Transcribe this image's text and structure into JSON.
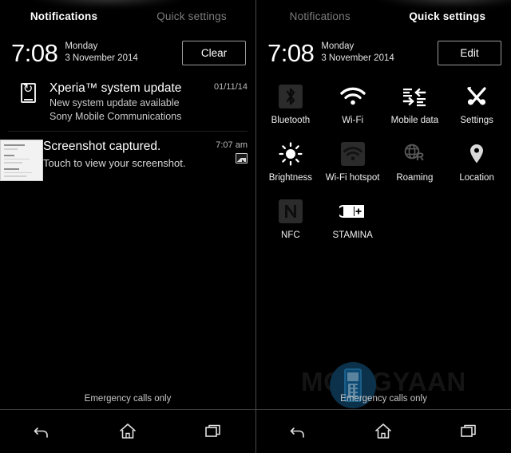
{
  "panels": {
    "left": {
      "tabs": [
        {
          "label": "Notifications",
          "active": true
        },
        {
          "label": "Quick settings",
          "active": false
        }
      ],
      "clock": {
        "time": "7:08",
        "day": "Monday",
        "date": "3 November 2014"
      },
      "action_button": "Clear",
      "notifications": [
        {
          "icon": "xperia-update-icon",
          "title": "Xperia™ system update",
          "line1": "New system update available",
          "line2": "Sony Mobile Communications",
          "time": "01/11/14"
        },
        {
          "icon": "screenshot-thumbnail",
          "title": "Screenshot captured.",
          "line1": "Touch to view your screenshot.",
          "line2": "",
          "time": "7:07 am"
        }
      ],
      "carrier_status": "Emergency calls only"
    },
    "right": {
      "tabs": [
        {
          "label": "Notifications",
          "active": false
        },
        {
          "label": "Quick settings",
          "active": true
        }
      ],
      "clock": {
        "time": "7:08",
        "day": "Monday",
        "date": "3 November 2014"
      },
      "action_button": "Edit",
      "tiles": [
        {
          "label": "Bluetooth",
          "icon": "bluetooth-icon",
          "state": "off"
        },
        {
          "label": "Wi-Fi",
          "icon": "wifi-icon",
          "state": "on"
        },
        {
          "label": "Mobile data",
          "icon": "mobile-data-icon",
          "state": "on"
        },
        {
          "label": "Settings",
          "icon": "settings-icon",
          "state": "on"
        },
        {
          "label": "Brightness",
          "icon": "brightness-icon",
          "state": "on"
        },
        {
          "label": "Wi-Fi hotspot",
          "icon": "wifi-hotspot-icon",
          "state": "off"
        },
        {
          "label": "Roaming",
          "icon": "roaming-icon",
          "state": "off"
        },
        {
          "label": "Location",
          "icon": "location-pin-icon",
          "state": "on"
        },
        {
          "label": "NFC",
          "icon": "nfc-icon",
          "state": "off"
        },
        {
          "label": "STAMINA",
          "icon": "stamina-battery-icon",
          "state": "on"
        }
      ],
      "carrier_status": "Emergency calls only"
    }
  },
  "navbar": {
    "buttons": [
      {
        "name": "back-button",
        "glyph": "back-icon"
      },
      {
        "name": "home-button",
        "glyph": "home-icon"
      },
      {
        "name": "recents-button",
        "glyph": "recents-icon"
      }
    ]
  },
  "watermark": {
    "text": "MOBIGYAAN"
  },
  "colors": {
    "background": "#000000",
    "text_primary": "#ffffff",
    "text_secondary": "#7d7d7d",
    "divider": "#3c3c3c",
    "tile_off": "#2b2b2b",
    "watermark_blue": "#0c3551"
  }
}
